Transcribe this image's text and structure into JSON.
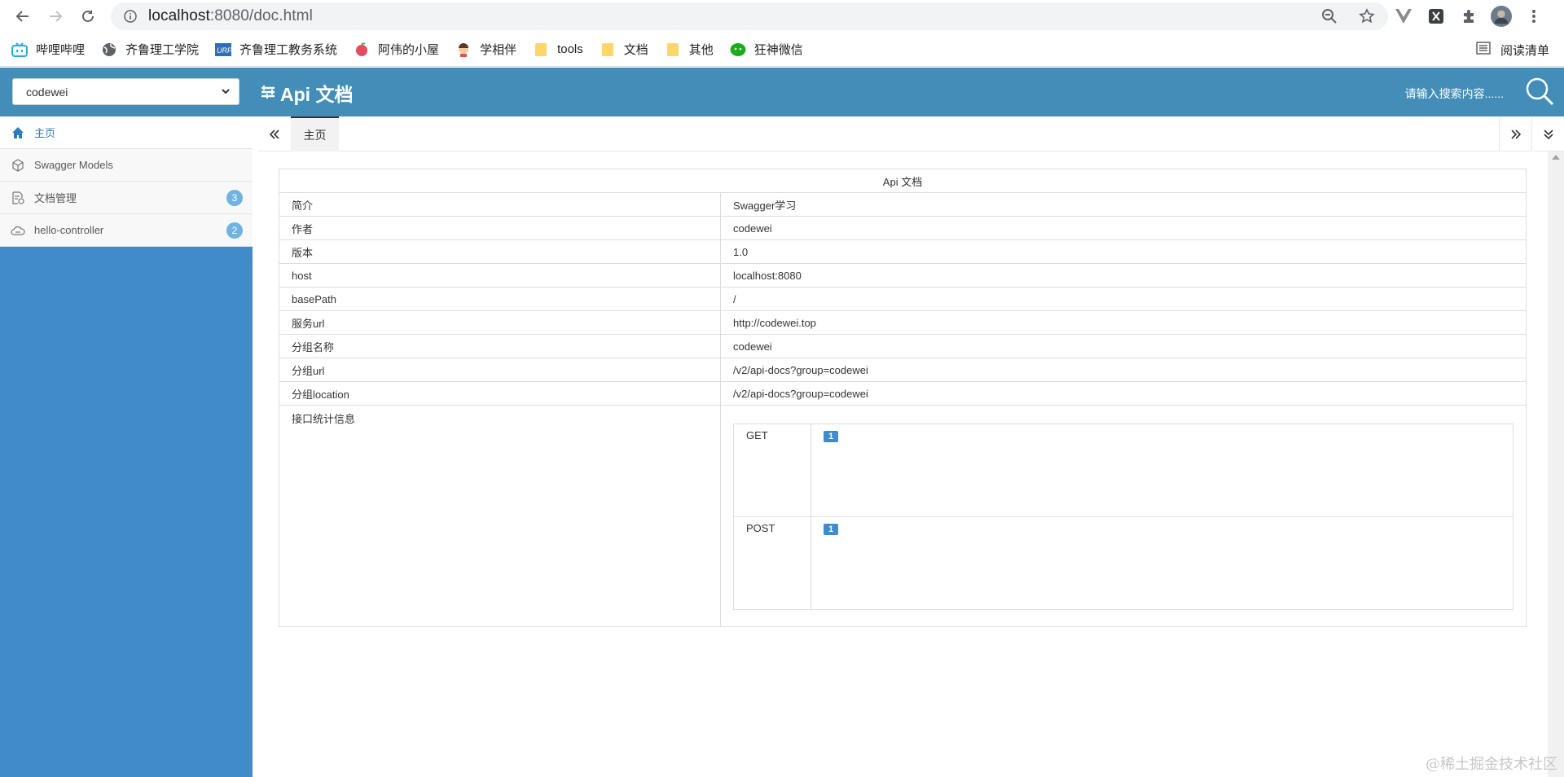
{
  "browser": {
    "url_host": "localhost",
    "url_rest": ":8080/doc.html",
    "bookmarks": [
      {
        "label": "哔哩哔哩",
        "icon": "bilibili-icon"
      },
      {
        "label": "齐鲁理工学院",
        "icon": "globe-icon"
      },
      {
        "label": "齐鲁理工教务系统",
        "icon": "urp-icon"
      },
      {
        "label": "阿伟的小屋",
        "icon": "peach-icon"
      },
      {
        "label": "学相伴",
        "icon": "avatar-icon"
      },
      {
        "label": "tools",
        "icon": "folder-icon"
      },
      {
        "label": "文档",
        "icon": "folder-icon"
      },
      {
        "label": "其他",
        "icon": "folder-icon"
      },
      {
        "label": "狂神微信",
        "icon": "wechat-icon"
      }
    ],
    "reading_list": "阅读清单"
  },
  "header": {
    "group_select": "codewei",
    "title": "Api 文档",
    "search_placeholder": "请输入搜索内容......"
  },
  "sidebar": {
    "items": [
      {
        "label": "主页",
        "icon": "home-icon"
      },
      {
        "label": "Swagger Models",
        "icon": "models-icon"
      },
      {
        "label": "文档管理",
        "icon": "doc-manage-icon",
        "badge": "3"
      },
      {
        "label": "hello-controller",
        "icon": "cloud-icon",
        "badge": "2"
      }
    ]
  },
  "tabs": {
    "home": "主页"
  },
  "doc": {
    "title": "Api 文档",
    "rows": [
      {
        "key": "简介",
        "value": "Swagger学习"
      },
      {
        "key": "作者",
        "value": "codewei"
      },
      {
        "key": "版本",
        "value": "1.0"
      },
      {
        "key": "host",
        "value": "localhost:8080"
      },
      {
        "key": "basePath",
        "value": "/"
      },
      {
        "key": "服务url",
        "value": "http://codewei.top"
      },
      {
        "key": "分组名称",
        "value": "codewei"
      },
      {
        "key": "分组url",
        "value": "/v2/api-docs?group=codewei"
      },
      {
        "key": "分组location",
        "value": "/v2/api-docs?group=codewei"
      }
    ],
    "stats_label": "接口统计信息",
    "stats": [
      {
        "method": "GET",
        "count": "1"
      },
      {
        "method": "POST",
        "count": "1"
      }
    ]
  },
  "watermark": "@稀土掘金技术社区",
  "colors": {
    "header": "#438eb9",
    "sidebar": "#428bca",
    "badge": "#6fb3e0"
  }
}
